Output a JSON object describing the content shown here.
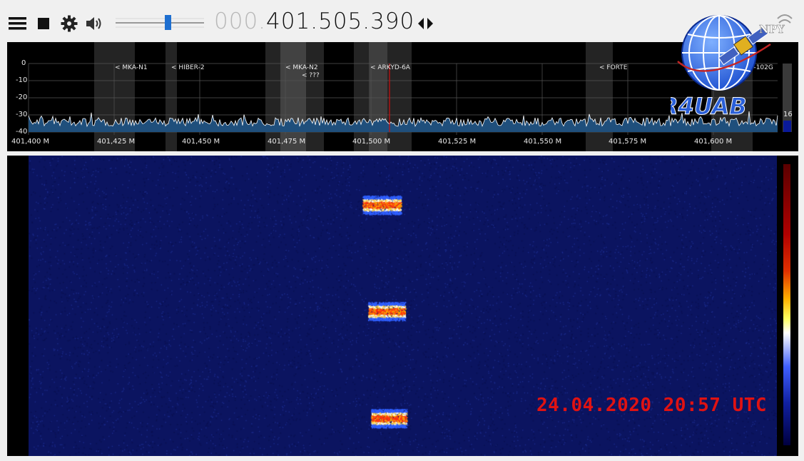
{
  "toolbar": {
    "freq_leading": "000.",
    "freq_main": "401.505.390",
    "volume_level": 0.6
  },
  "spectrum": {
    "y_ticks": [
      "0",
      "-10",
      "-20",
      "-30",
      "-40"
    ],
    "x_ticks": [
      "401,400 M",
      "401,425 M",
      "401,450 M",
      "401,475 M",
      "401,500 M",
      "401,525 M",
      "401,550 M",
      "401,575 M",
      "401,600 M"
    ],
    "level_value": "16",
    "satellites": [
      "< MKA-N1",
      "< HIBER-2",
      "< MKA-N2",
      "< ???",
      "< ARKYD-6A",
      "< FORTE",
      "18-102G"
    ]
  },
  "logo": {
    "callsign": "R4UAB",
    "text": "NPY"
  },
  "waterfall": {
    "timestamp": "24.04.2020 20:57 UTC"
  },
  "colors": {
    "waterfall_bg": "#0b1460",
    "accent": "#1e6fd0",
    "marker": "#d01010",
    "stamp": "#e01212"
  }
}
